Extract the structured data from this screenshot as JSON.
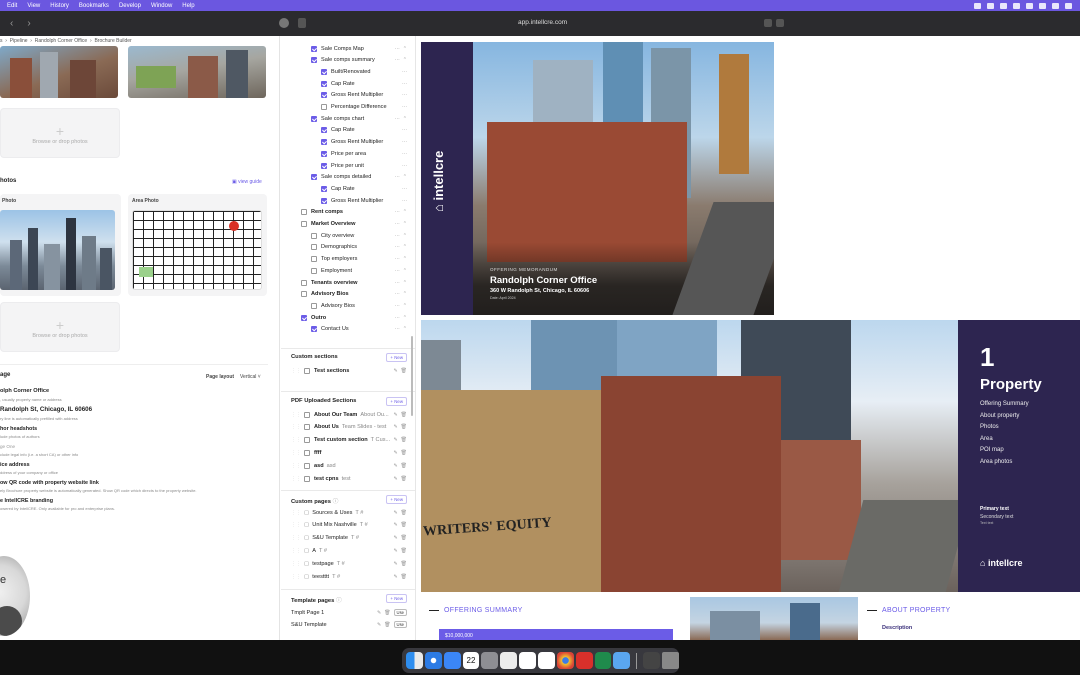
{
  "menubar": {
    "items": [
      "Edit",
      "View",
      "History",
      "Bookmarks",
      "Develop",
      "Window",
      "Help"
    ],
    "accent": "#6b57e0"
  },
  "browser": {
    "url": "app.intellcre.com",
    "back_icon": "chevron-left-icon",
    "forward_icon": "chevron-right-icon"
  },
  "breadcrumb": {
    "items": [
      "s",
      "Pipeline",
      "Randolph Corner Office",
      "Brochure Builder"
    ]
  },
  "left_pane": {
    "drop_label": "Browse or drop photos",
    "photos_header": "hotos",
    "view_guide": "view guide",
    "photo_label": "Photo",
    "area_photo_label": "Area Photo",
    "page_header": "age",
    "page_layout_label": "Page layout",
    "page_layout_value": "Vertical",
    "fields": [
      {
        "title": "olph Corner Office",
        "desc": ", usually property name or address"
      },
      {
        "title": "Randolph St, Chicago, IL 60606",
        "desc": "ry line is automatically prefilled with address"
      },
      {
        "title": "hor headshots",
        "desc": "lude photos of authors"
      },
      {
        "title": "ge One",
        "desc": "clude legal info (i.e. a short CA) or other info"
      },
      {
        "title": "ice address",
        "desc": "ddress of your company or office"
      },
      {
        "title": "ow QR code with property website link",
        "desc": "ely Brochure property website is automatically generated. Show QR code which directs to the property website."
      },
      {
        "title": "e IntellCRE branding",
        "desc": "owered by IntellCRE. Only available for pro and enterprise plans."
      }
    ],
    "avatar_letter": "e"
  },
  "sections": {
    "rows": [
      {
        "label": "Sale Comps Map",
        "level": 1,
        "checked": true
      },
      {
        "label": "Sale comps summary",
        "level": 1,
        "checked": true
      },
      {
        "label": "Built/Renovated",
        "level": 2,
        "checked": true
      },
      {
        "label": "Cap Rate",
        "level": 2,
        "checked": true
      },
      {
        "label": "Gross Rent Multiplier",
        "level": 2,
        "checked": true
      },
      {
        "label": "Percentage Difference",
        "level": 2,
        "checked": false
      },
      {
        "label": "Sale comps chart",
        "level": 1,
        "checked": true
      },
      {
        "label": "Cap Rate",
        "level": 2,
        "checked": true
      },
      {
        "label": "Gross Rent Multiplier",
        "level": 2,
        "checked": true
      },
      {
        "label": "Price per area",
        "level": 2,
        "checked": true
      },
      {
        "label": "Price per unit",
        "level": 2,
        "checked": true
      },
      {
        "label": "Sale comps detailed",
        "level": 1,
        "checked": true
      },
      {
        "label": "Cap Rate",
        "level": 2,
        "checked": true
      },
      {
        "label": "Gross Rent Multiplier",
        "level": 2,
        "checked": true
      },
      {
        "label": "Rent comps",
        "level": 0,
        "checked": false
      },
      {
        "label": "Market Overview",
        "level": 0,
        "checked": false
      },
      {
        "label": "City overview",
        "level": 1,
        "checked": false
      },
      {
        "label": "Demographics",
        "level": 1,
        "checked": false
      },
      {
        "label": "Top employers",
        "level": 1,
        "checked": false
      },
      {
        "label": "Employment",
        "level": 1,
        "checked": false
      },
      {
        "label": "Tenants overview",
        "level": 0,
        "checked": false
      },
      {
        "label": "Advisory Bios",
        "level": 0,
        "checked": false
      },
      {
        "label": "Advisory Bios",
        "level": 1,
        "checked": false
      },
      {
        "label": "Outro",
        "level": 0,
        "checked": true
      },
      {
        "label": "Contact Us",
        "level": 1,
        "checked": true
      }
    ],
    "custom_header": "Custom sections",
    "new_label": "+ New",
    "custom_rows": [
      "Test sections"
    ],
    "pdf_header": "PDF Uploaded Sections",
    "pdf_rows": [
      {
        "title": "About Our Team",
        "sub": "About Ou..."
      },
      {
        "title": "About Us",
        "sub": "Team Slides - test"
      },
      {
        "title": "Test custom section",
        "sub": "T Cus..."
      },
      {
        "title": "ffff",
        "sub": ""
      },
      {
        "title": "asd",
        "sub": "asd"
      },
      {
        "title": "test cpns",
        "sub": "test"
      }
    ],
    "custom_pages_header": "Custom pages",
    "custom_pages": [
      "Sources & Uses",
      "Unit Mix Nashville",
      "S&U Template",
      "A",
      "testpage",
      "teestttt"
    ],
    "template_header": "Template pages",
    "template_pages": [
      "Tmplt Page 1",
      "S&U Template"
    ],
    "use_label": "Use"
  },
  "preview": {
    "cover": {
      "brand": "intellcre",
      "eyebrow": "OFFERING MEMORANDUM",
      "title": "Randolph Corner Office",
      "address": "360 W Randolph St, Chicago, IL 60606",
      "date": "Date: April 2024",
      "sidebar_color": "#2d2550"
    },
    "section": {
      "number": "1",
      "title": "Property",
      "items": [
        "Offering Summary",
        "About property",
        "Photos",
        "Area",
        "POI map",
        "Area photos"
      ],
      "primary_text": "Primary text",
      "secondary_text": "Secondary text",
      "more_text": "Text text",
      "brand": "intellcre",
      "sign_text": "WRITERS' EQUITY"
    },
    "bottom": {
      "offering_summary": "OFFERING SUMMARY",
      "about_property": "ABOUT PROPERTY",
      "description": "Description",
      "price": "$10,000,000"
    },
    "accent": "#6b5ce7"
  },
  "dock": {
    "calendar_day": "22",
    "icons": [
      "finder-icon",
      "safari-icon",
      "mail-icon",
      "calendar-icon",
      "settings-icon",
      "music-icon",
      "slack-icon",
      "notion-icon",
      "chrome-icon",
      "acrobat-icon",
      "excel-icon",
      "preview-icon",
      "downloads-icon",
      "trash-icon"
    ]
  }
}
